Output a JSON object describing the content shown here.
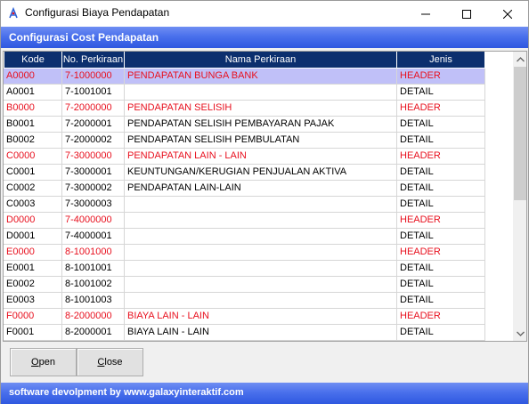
{
  "window": {
    "title": "Configurasi Biaya Pendapatan"
  },
  "header": {
    "title": "Configurasi Cost Pendapatan"
  },
  "table": {
    "columns": [
      "Kode",
      "No. Perkiraan",
      "Nama Perkiraan",
      "Jenis"
    ],
    "rows": [
      {
        "kode": "A0000",
        "no": "7-1000000",
        "nama": "PENDAPATAN BUNGA BANK",
        "jenis": "HEADER"
      },
      {
        "kode": "A0001",
        "no": "7-1001001",
        "nama": "",
        "jenis": "DETAIL"
      },
      {
        "kode": "B0000",
        "no": "7-2000000",
        "nama": "PENDAPATAN SELISIH",
        "jenis": "HEADER"
      },
      {
        "kode": "B0001",
        "no": "7-2000001",
        "nama": "PENDAPATAN SELISIH PEMBAYARAN PAJAK",
        "jenis": "DETAIL"
      },
      {
        "kode": "B0002",
        "no": "7-2000002",
        "nama": "PENDAPATAN SELISIH PEMBULATAN",
        "jenis": "DETAIL"
      },
      {
        "kode": "C0000",
        "no": "7-3000000",
        "nama": "PENDAPATAN LAIN - LAIN",
        "jenis": "HEADER"
      },
      {
        "kode": "C0001",
        "no": "7-3000001",
        "nama": "KEUNTUNGAN/KERUGIAN PENJUALAN AKTIVA",
        "jenis": "DETAIL"
      },
      {
        "kode": "C0002",
        "no": "7-3000002",
        "nama": "PENDAPATAN LAIN-LAIN",
        "jenis": "DETAIL"
      },
      {
        "kode": "C0003",
        "no": "7-3000003",
        "nama": "",
        "jenis": "DETAIL"
      },
      {
        "kode": "D0000",
        "no": "7-4000000",
        "nama": "",
        "jenis": "HEADER"
      },
      {
        "kode": "D0001",
        "no": "7-4000001",
        "nama": "",
        "jenis": "DETAIL"
      },
      {
        "kode": "E0000",
        "no": "8-1001000",
        "nama": "",
        "jenis": "HEADER"
      },
      {
        "kode": "E0001",
        "no": "8-1001001",
        "nama": "",
        "jenis": "DETAIL"
      },
      {
        "kode": "E0002",
        "no": "8-1001002",
        "nama": "",
        "jenis": "DETAIL"
      },
      {
        "kode": "E0003",
        "no": "8-1001003",
        "nama": "",
        "jenis": "DETAIL"
      },
      {
        "kode": "F0000",
        "no": "8-2000000",
        "nama": "BIAYA LAIN - LAIN",
        "jenis": "HEADER"
      },
      {
        "kode": "F0001",
        "no": "8-2000001",
        "nama": "BIAYA LAIN - LAIN",
        "jenis": "DETAIL"
      }
    ]
  },
  "buttons": {
    "open_label": "Open",
    "close_label": "Close"
  },
  "footer": {
    "text": "software devolpment by www.galaxyinteraktif.com"
  },
  "colors": {
    "header_row_text": "#e8101e",
    "band_blue": "#4a70ec",
    "grid_header_bg": "#0c2f6e",
    "selected_row_bg": "#c0c0f8"
  },
  "icons": [
    "app-icon",
    "minimize-icon",
    "maximize-icon",
    "close-icon",
    "scroll-up-arrow-icon",
    "scroll-down-arrow-icon"
  ]
}
